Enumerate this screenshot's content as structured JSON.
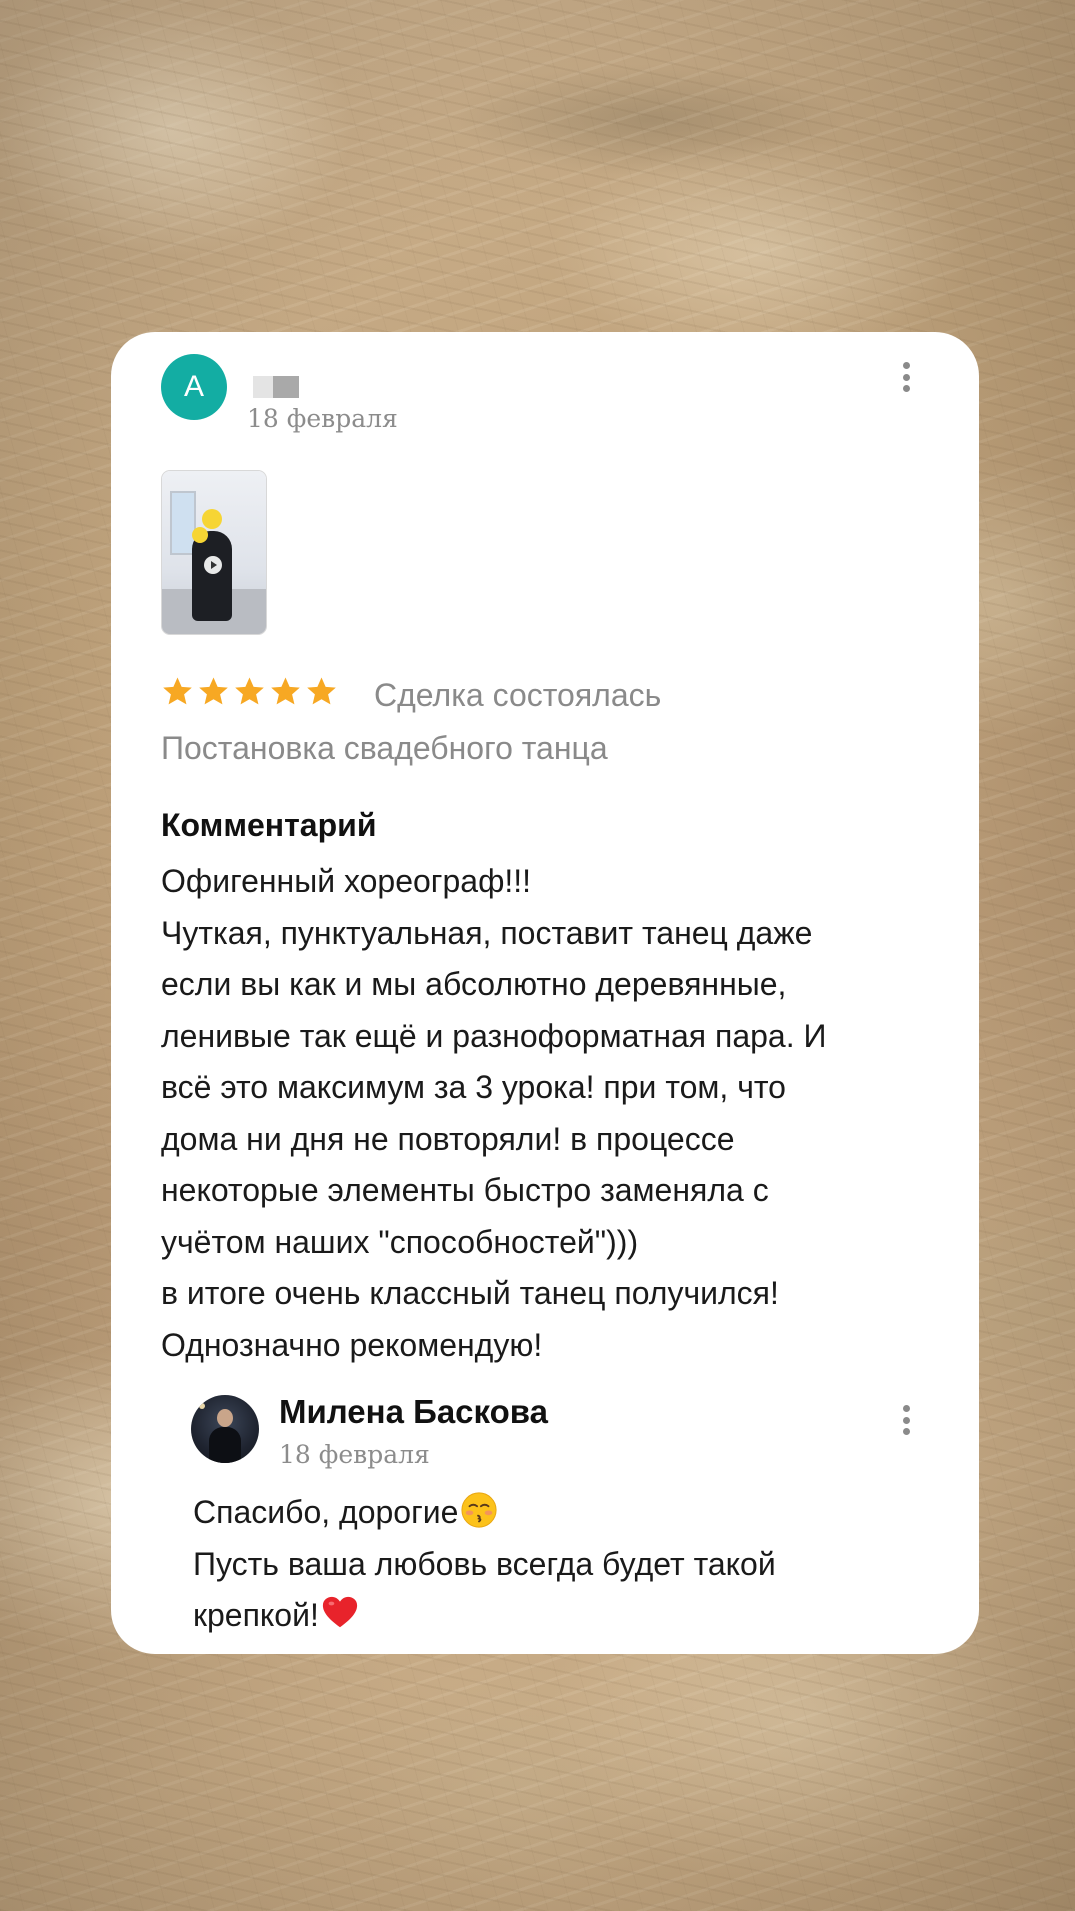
{
  "review": {
    "avatar_letter": "A",
    "date": "18 февраля",
    "rating": 5,
    "rating_max": 5,
    "deal_status": "Сделка состоялась",
    "service": "Постановка свадебного танца",
    "comment_heading": "Комментарий",
    "comment_lines": [
      "Офигенный хореограф!!!",
      "Чуткая, пунктуальная, поставит танец даже",
      "если вы как и мы абсолютно деревянные,",
      "ленивые так ещё и разноформатная пара. И",
      "всё это максимум за 3 урока! при том, что",
      "дома ни дня не повторяли! в процессе",
      "некоторые элементы быстро заменяла с",
      "учётом наших \"способностей\")))",
      "в итоге очень классный танец получился!",
      "Однозначно рекомендую!"
    ]
  },
  "reply": {
    "name": "Милена Баскова",
    "date": "18 февраля",
    "line_1": "Спасибо, дорогие",
    "line_1_emoji": "kissing-face-with-closed-eyes-emoji",
    "line_2": "Пусть ваша любовь всегда будет такой",
    "line_3": "крепкой!",
    "line_3_emoji": "red-heart-emoji"
  },
  "icons": {
    "star": "star-icon",
    "menu": "more-vertical-icon",
    "play": "play-icon"
  },
  "colors": {
    "avatar_bg": "#13ada3",
    "star": "#f7a823",
    "muted_text": "#8a8a8a",
    "card_bg": "#ffffff"
  }
}
